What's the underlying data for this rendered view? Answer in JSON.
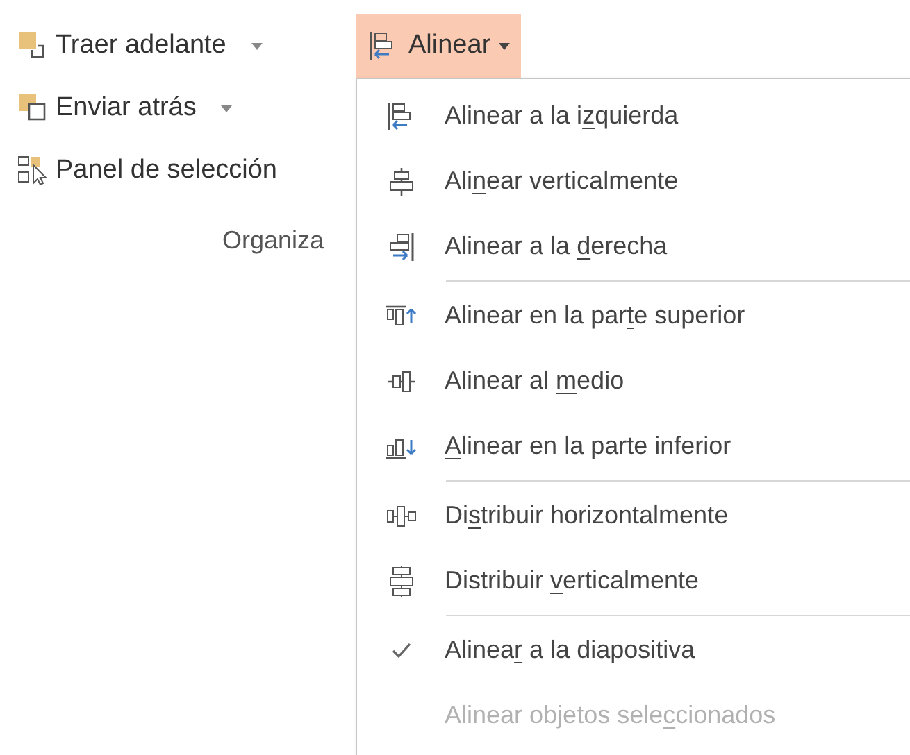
{
  "ribbon_buttons": [
    {
      "label": "Traer adelante",
      "kind": "bring-forward",
      "dropdown": true
    },
    {
      "label": "Enviar atrás",
      "kind": "send-backward",
      "dropdown": true
    },
    {
      "label": "Panel de selección",
      "kind": "selection-pane",
      "dropdown": false
    }
  ],
  "group_label": "Organiza",
  "align_button": {
    "label": "Alinear",
    "selected": true
  },
  "menu": [
    {
      "kind": "align-left",
      "before": "Alinear a la i",
      "key": "z",
      "after": "quierda",
      "checked": false,
      "disabled": false
    },
    {
      "kind": "align-center",
      "before": "Ali",
      "key": "n",
      "after": "ear verticalmente",
      "checked": false,
      "disabled": false
    },
    {
      "kind": "align-right",
      "before": "Alinear a la ",
      "key": "d",
      "after": "erecha",
      "checked": false,
      "disabled": false
    },
    {
      "kind": "separator"
    },
    {
      "kind": "align-top",
      "before": "Alinear en la par",
      "key": "t",
      "after": "e superior",
      "checked": false,
      "disabled": false
    },
    {
      "kind": "align-middle",
      "before": "Alinear al ",
      "key": "m",
      "after": "edio",
      "checked": false,
      "disabled": false
    },
    {
      "kind": "align-bottom",
      "key": "A",
      "after": "linear en la parte inferior",
      "checked": false,
      "disabled": false
    },
    {
      "kind": "separator"
    },
    {
      "kind": "distribute-h",
      "before": "Di",
      "key": "s",
      "after": "tribuir horizontalmente",
      "checked": false,
      "disabled": false
    },
    {
      "kind": "distribute-v",
      "before": "Distribuir ",
      "key": "v",
      "after": "erticalmente",
      "checked": false,
      "disabled": false
    },
    {
      "kind": "separator"
    },
    {
      "kind": "option",
      "before": "Alinea",
      "key": "r",
      "after": " a la diapositiva",
      "checked": true,
      "disabled": false
    },
    {
      "kind": "option",
      "before": "Alinear objetos sele",
      "key": "c",
      "after": "cionados",
      "checked": false,
      "disabled": true
    }
  ]
}
